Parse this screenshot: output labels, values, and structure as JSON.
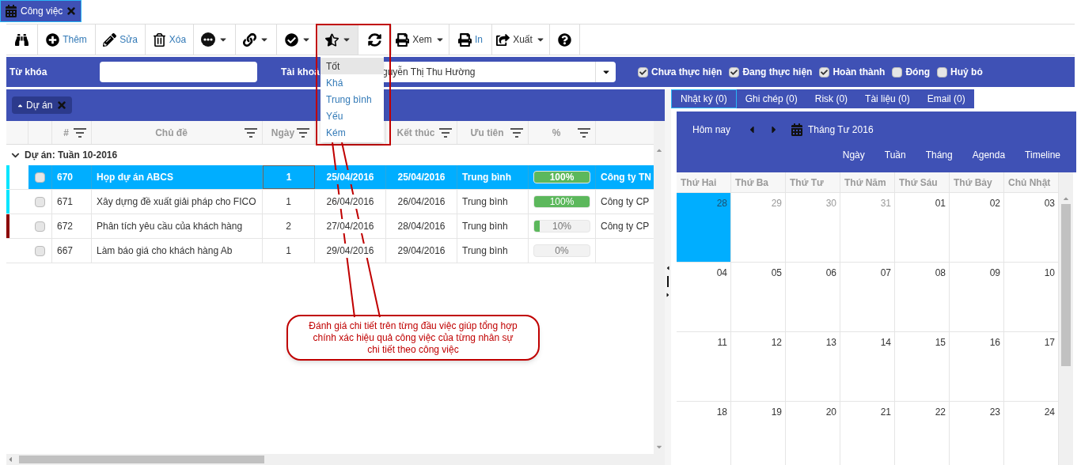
{
  "doc_tab": {
    "label": "Công việc"
  },
  "toolbar": [
    {
      "kind": "search",
      "dropdown": false,
      "pressed": false
    },
    {
      "kind": "add",
      "label": "Thêm",
      "dropdown": false,
      "pressed": false
    },
    {
      "kind": "edit",
      "label": "Sửa",
      "dropdown": false,
      "pressed": false
    },
    {
      "kind": "delete",
      "label": "Xóa",
      "dropdown": false,
      "pressed": false
    },
    {
      "kind": "more",
      "dropdown": true,
      "pressed": false
    },
    {
      "kind": "link",
      "dropdown": true,
      "pressed": false
    },
    {
      "kind": "check",
      "dropdown": true,
      "pressed": false
    },
    {
      "kind": "rate",
      "dropdown": true,
      "pressed": true
    },
    {
      "kind": "refresh",
      "dropdown": false,
      "pressed": false
    },
    {
      "kind": "print",
      "label": "Xem",
      "dropdown": true,
      "pressed": false
    },
    {
      "kind": "print",
      "label": "In",
      "dropdown": false,
      "pressed": false
    },
    {
      "kind": "export",
      "label": "Xuất",
      "dropdown": true,
      "pressed": false
    },
    {
      "kind": "help",
      "dropdown": false,
      "pressed": false
    }
  ],
  "filter": {
    "keyword_label": "Từ khóa",
    "account_label": "Tài khoả",
    "account_value": "guyễn Thị Thu Hường",
    "statuses": [
      {
        "label": "Chưa thực hiện",
        "checked": true
      },
      {
        "label": "Đang thực hiện",
        "checked": true
      },
      {
        "label": "Hoàn thành",
        "checked": true
      },
      {
        "label": "Đóng",
        "checked": false
      },
      {
        "label": "Huỷ bỏ",
        "checked": false
      }
    ]
  },
  "rating_menu": [
    {
      "label": "Tốt",
      "selected": true
    },
    {
      "label": "Khá",
      "selected": false
    },
    {
      "label": "Trung bình",
      "selected": false
    },
    {
      "label": "Yếu",
      "selected": false
    },
    {
      "label": "Kém",
      "selected": false
    }
  ],
  "grouping_chip": "Dự án",
  "columns": [
    "#",
    "Chủ đề",
    "Ngày",
    "Kết thúc",
    "Ưu tiên",
    "%"
  ],
  "group": {
    "label": "Dự án: Tuần 10-2016",
    "expanded": true
  },
  "rows": [
    {
      "id": "670",
      "subject": "Họp dự án ABCS",
      "days": "1",
      "start": "25/04/2016",
      "end": "25/04/2016",
      "priority": "Trung bình",
      "level": 1,
      "percent": "100%",
      "company": "Công ty TN",
      "color": "#00e5ff",
      "selected": true,
      "checked": false
    },
    {
      "id": "671",
      "subject": "Xây dựng đề xuất giải pháp cho FICO",
      "days": "1",
      "start": "26/04/2016",
      "end": "26/04/2016",
      "priority": "Trung bình",
      "level": 1,
      "percent": "100%",
      "company": "Công ty CP",
      "color": "#00e5ff",
      "selected": false,
      "checked": false
    },
    {
      "id": "672",
      "subject": "Phân tích yêu cầu của khách hàng",
      "days": "2",
      "start": "27/04/2016",
      "end": "28/04/2016",
      "priority": "Trung bình",
      "level": 0.1,
      "percent": "10%",
      "company": "Công ty CP",
      "color": "#8b0000",
      "selected": false,
      "checked": false
    },
    {
      "id": "667",
      "subject": "Làm báo giá cho khách hàng Ab",
      "days": "1",
      "start": "29/04/2016",
      "end": "29/04/2016",
      "priority": "Trung bình",
      "level": 0,
      "percent": "0%",
      "selected": false,
      "checked": false
    }
  ],
  "side_tabs": [
    {
      "label": "Nhật ký (0)",
      "selected": true
    },
    {
      "label": "Ghi chép (0)",
      "selected": false
    },
    {
      "label": "Risk (0)",
      "selected": false
    },
    {
      "label": "Tài liệu (0)",
      "selected": false
    },
    {
      "label": "Email (0)",
      "selected": false
    }
  ],
  "calendar": {
    "today": "Hôm nay",
    "title": "Tháng Tư 2016",
    "views": [
      "Ngày",
      "Tuần",
      "Tháng",
      "Agenda",
      "Timeline"
    ],
    "weekdays": [
      "Thứ Hai",
      "Thứ Ba",
      "Thứ Tư",
      "Thứ Năm",
      "Thứ Sáu",
      "Thứ Bảy",
      "Chủ Nhật"
    ],
    "weeks": [
      [
        {
          "day": "28",
          "other_month": true,
          "selected": true
        },
        {
          "day": "29",
          "other_month": true,
          "selected": false
        },
        {
          "day": "30",
          "other_month": true,
          "selected": false
        },
        {
          "day": "31",
          "other_month": true,
          "selected": false
        },
        {
          "day": "01",
          "other_month": false,
          "selected": false
        },
        {
          "day": "02",
          "other_month": false,
          "selected": false
        },
        {
          "day": "03",
          "other_month": false,
          "selected": false
        }
      ],
      [
        {
          "day": "04",
          "other_month": false,
          "selected": false
        },
        {
          "day": "05",
          "other_month": false,
          "selected": false
        },
        {
          "day": "06",
          "other_month": false,
          "selected": false
        },
        {
          "day": "07",
          "other_month": false,
          "selected": false
        },
        {
          "day": "08",
          "other_month": false,
          "selected": false
        },
        {
          "day": "09",
          "other_month": false,
          "selected": false
        },
        {
          "day": "10",
          "other_month": false,
          "selected": false
        }
      ],
      [
        {
          "day": "11",
          "other_month": false,
          "selected": false
        },
        {
          "day": "12",
          "other_month": false,
          "selected": false
        },
        {
          "day": "13",
          "other_month": false,
          "selected": false
        },
        {
          "day": "14",
          "other_month": false,
          "selected": false
        },
        {
          "day": "15",
          "other_month": false,
          "selected": false
        },
        {
          "day": "16",
          "other_month": false,
          "selected": false
        },
        {
          "day": "17",
          "other_month": false,
          "selected": false
        }
      ],
      [
        {
          "day": "18",
          "other_month": false,
          "selected": false
        },
        {
          "day": "19",
          "other_month": false,
          "selected": false
        },
        {
          "day": "20",
          "other_month": false,
          "selected": false
        },
        {
          "day": "21",
          "other_month": false,
          "selected": false
        },
        {
          "day": "22",
          "other_month": false,
          "selected": false
        },
        {
          "day": "23",
          "other_month": false,
          "selected": false
        },
        {
          "day": "24",
          "other_month": false,
          "selected": false
        }
      ]
    ]
  },
  "callout": "Đánh giá chi tiết trên từng đầu việc giúp tổng hợp chính xác hiệu quả công việc của từng nhân sự chi tiết theo công việc"
}
